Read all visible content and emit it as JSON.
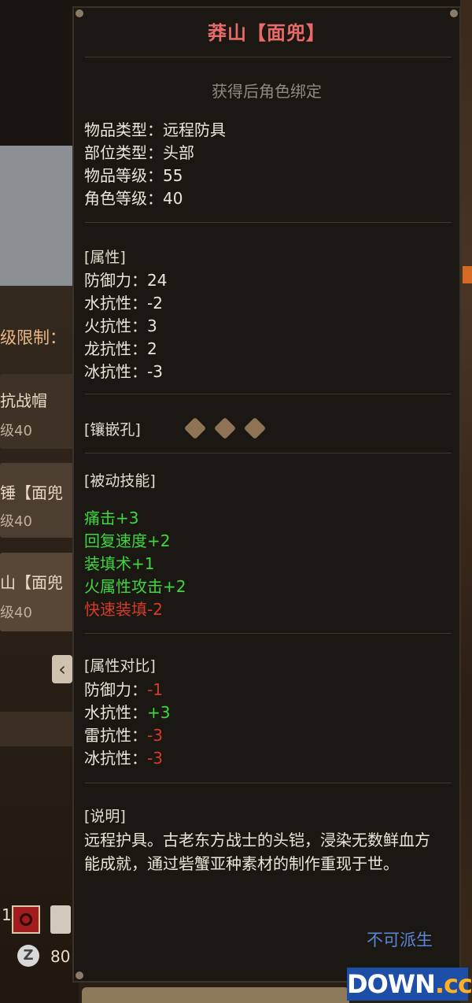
{
  "item": {
    "title": "莽山【面兜】",
    "bind_note": "获得后角色绑定",
    "info": [
      {
        "label": "物品类型：",
        "value": "远程防具"
      },
      {
        "label": "部位类型：",
        "value": "头部"
      },
      {
        "label": "物品等级：",
        "value": "55"
      },
      {
        "label": "角色等级：",
        "value": "40"
      }
    ],
    "attributes": {
      "header": "[属性]",
      "rows": [
        {
          "label": "防御力：",
          "value": "24"
        },
        {
          "label": "水抗性：",
          "value": "-2"
        },
        {
          "label": "火抗性：",
          "value": "3"
        },
        {
          "label": "龙抗性：",
          "value": "2"
        },
        {
          "label": "冰抗性：",
          "value": "-3"
        }
      ]
    },
    "sockets": {
      "header": "[镶嵌孔]",
      "count": 3
    },
    "passive_skills": {
      "header": "[被动技能]",
      "rows": [
        {
          "text": "痛击+3",
          "color": "#3fd63f"
        },
        {
          "text": "回复速度+2",
          "color": "#3fd63f"
        },
        {
          "text": "装填术+1",
          "color": "#3fd63f"
        },
        {
          "text": "火属性攻击+2",
          "color": "#3fd63f"
        },
        {
          "text": "快速装填-2",
          "color": "#d63a2a"
        }
      ]
    },
    "compare": {
      "header": "[属性对比]",
      "rows": [
        {
          "label": "防御力：",
          "value": "-1",
          "color": "#d63a2a"
        },
        {
          "label": "水抗性：",
          "value": "+3",
          "color": "#3fd63f"
        },
        {
          "label": "雷抗性：",
          "value": "-3",
          "color": "#d63a2a"
        },
        {
          "label": "冰抗性：",
          "value": "-3",
          "color": "#d63a2a"
        }
      ]
    },
    "description": {
      "header": "[说明]",
      "text": "远程护具。古老东方战士的头铠，浸染无数鲜血方能成就，通过砦蟹亚种素材的制作重现于世。"
    },
    "derive_status": "不可派生"
  },
  "background": {
    "level_limit_label": "级限制：",
    "list": [
      {
        "name": "抗战帽",
        "sub": "级40"
      },
      {
        "name": "锤【面兜",
        "sub": "级40"
      },
      {
        "name": "山【面兜",
        "sub": "级40"
      }
    ],
    "bottom_number_1": "1",
    "bottom_number_2": "80"
  },
  "watermark": {
    "main": "DOWN",
    "suffix": ".cc"
  }
}
